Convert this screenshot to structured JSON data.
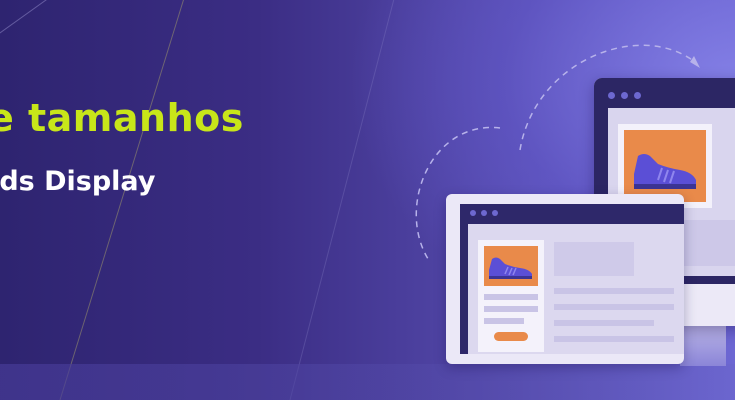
{
  "banner": {
    "headline": "e tamanhos",
    "subheadline": "rds Display"
  },
  "colors": {
    "headline": "#c8e619",
    "subheadline": "#ffffff",
    "background_dark": "#2e2470",
    "background_light": "#6d67d3",
    "ad_image": "#e98a4a",
    "shoe": "#5b4fd6"
  },
  "icons": {
    "monitor_ad": "sneaker-icon",
    "tablet_ad": "sneaker-icon",
    "arrow": "dashed-arrow"
  }
}
